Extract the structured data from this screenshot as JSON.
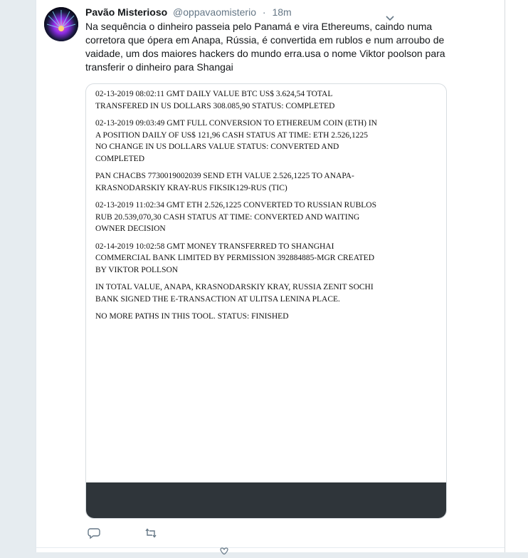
{
  "tweet": {
    "display_name": "Pavão Misterioso",
    "handle": "@oppavaomisterio",
    "separator": "·",
    "time": "18m",
    "text": "Na sequência o dinheiro passeia pelo Panamá e vira Ethereums, caindo numa corretora que ópera em Anapa, Rússia, é convertida em rublos e num arroubo de vaidade, um dos maiores hackers do mundo erra.usa o nome Viktor poolson para transferir o dinheiro para Shangai"
  },
  "document": {
    "paragraphs": [
      [
        "02-13-2019 08:02:11 GMT  DAILY VALUE BTC US$ 3.624,54 TOTAL",
        "TRANSFERED IN US DOLLARS 308.085,90 STATUS: COMPLETED"
      ],
      [
        "02-13-2019 09:03:49 GMT FULL CONVERSION TO ETHEREUM COIN (ETH)  IN",
        "A POSITION DAILY OF US$ 121,96  CASH STATUS AT TIME:  ETH 2.526,1225",
        "NO CHANGE IN US DOLLARS VALUE STATUS: CONVERTED AND",
        "COMPLETED"
      ],
      [
        "PAN CHACBS 7730019002039 SEND ETH VALUE 2.526,1225   TO ANAPA-",
        "KRASNODARSKIY KRAY-RUS FIKSIK129-RUS (TIC)"
      ],
      [
        "02-13-2019 11:02:34 GMT ETH 2.526,1225 CONVERTED TO RUSSIAN RUBLOS",
        "RUB 20.539,070,30  CASH STATUS AT TIME: CONVERTED AND WAITING",
        "OWNER DECISION"
      ],
      [
        "02-14-2019 10:02:58 GMT MONEY TRANSFERRED TO SHANGHAI",
        "COMMERCIAL BANK LIMITED BY PERMISSION 392884885-MGR CREATED",
        "BY VIKTOR POLLSON"
      ],
      [
        "IN TOTAL VALUE, ANAPA, KRASNODARSKIY KRAY, RUSSIA ZENIT SOCHI",
        "BANK SIGNED THE E-TRANSACTION AT ULITSA LENINA PLACE."
      ],
      [
        "NO MORE PATHS IN THIS TOOL.  STATUS: FINISHED"
      ]
    ]
  },
  "icons": {
    "reply": "reply-icon",
    "retweet": "retweet-icon",
    "caret": "chevron-down-icon",
    "like": "heart-icon"
  },
  "colors": {
    "name": "#14171a",
    "muted": "#657786",
    "page_bg": "#e6ecf0",
    "media_dark_bar": "#2f353a"
  }
}
